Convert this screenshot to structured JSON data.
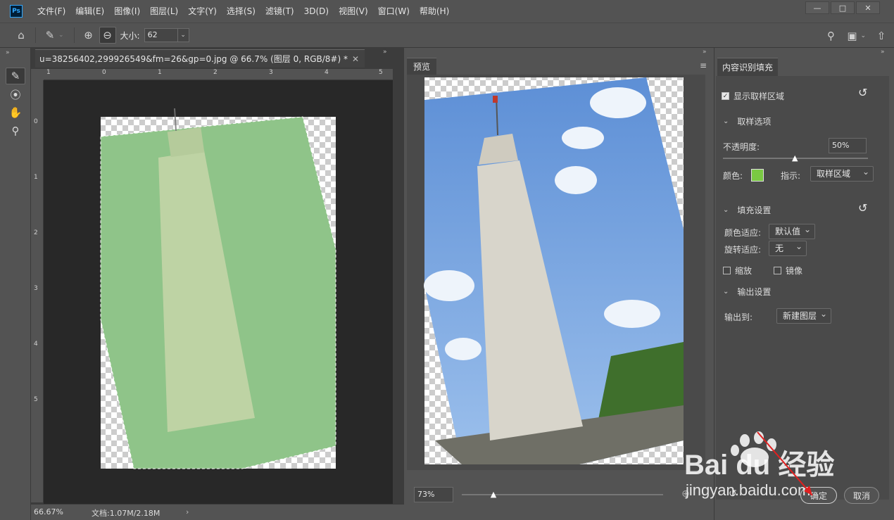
{
  "app": {
    "logo": "Ps"
  },
  "menu": [
    "文件(F)",
    "编辑(E)",
    "图像(I)",
    "图层(L)",
    "文字(Y)",
    "选择(S)",
    "滤镜(T)",
    "3D(D)",
    "视图(V)",
    "窗口(W)",
    "帮助(H)"
  ],
  "options": {
    "size_label": "大小:",
    "size_value": "62"
  },
  "document": {
    "tab_title": "u=38256402,299926549&fm=26&gp=0.jpg @ 66.7% (图层 0, RGB/8#) *",
    "ruler_h": [
      "1",
      "0",
      "1",
      "2",
      "3",
      "4",
      "5"
    ],
    "ruler_v": [
      "0",
      "1",
      "2",
      "3",
      "4",
      "5"
    ],
    "zoom": "66.67%",
    "doc_info": "文档:1.07M/2.18M"
  },
  "preview": {
    "tab_label": "预览",
    "zoom_value": "73%",
    "zoom_fraction": 0.16
  },
  "panel": {
    "title": "内容识别填充",
    "show_sampling_area": "显示取样区域",
    "sampling_options": "取样选项",
    "opacity_label": "不透明度:",
    "opacity_value": "50%",
    "opacity_fraction": 0.5,
    "color_label": "颜色:",
    "sample_color": "#7ac943",
    "indicate_label": "指示:",
    "indicate_value": "取样区域",
    "fill_settings": "填充设置",
    "color_adapt_label": "颜色适应:",
    "color_adapt_value": "默认值",
    "rotation_adapt_label": "旋转适应:",
    "rotation_adapt_value": "无",
    "scale_label": "缩放",
    "mirror_label": "镜像",
    "output_settings": "输出设置",
    "output_to_label": "输出到:",
    "output_to_value": "新建图层",
    "ok_label": "确定",
    "cancel_label": "取消"
  },
  "watermark": {
    "brand": "Bai du 经验",
    "url": "jingyan.baidu.com"
  }
}
